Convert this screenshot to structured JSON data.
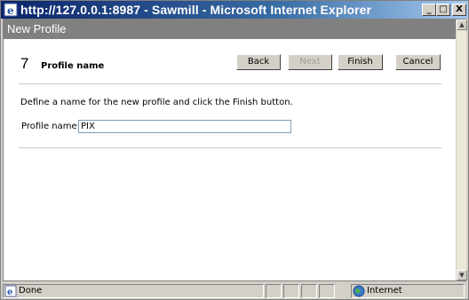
{
  "window": {
    "title": "http://127.0.0.1:8987 - Sawmill - Microsoft Internet Explorer",
    "minimize": "_",
    "maximize": "□",
    "close": "X"
  },
  "page": {
    "header": "New Profile",
    "step_number": "7",
    "step_title": "Profile name",
    "buttons": {
      "back": "Back",
      "next": "Next",
      "finish": "Finish",
      "cancel": "Cancel"
    },
    "instruction": "Define a name for the new profile and click the Finish button.",
    "profile_label": "Profile name:",
    "profile_value": "PIX"
  },
  "statusbar": {
    "status": "Done",
    "zone": "Internet"
  },
  "icons": {
    "window_icon": "ie-icon",
    "status_icon": "page-done-icon",
    "zone_icon": "internet-globe-icon"
  }
}
